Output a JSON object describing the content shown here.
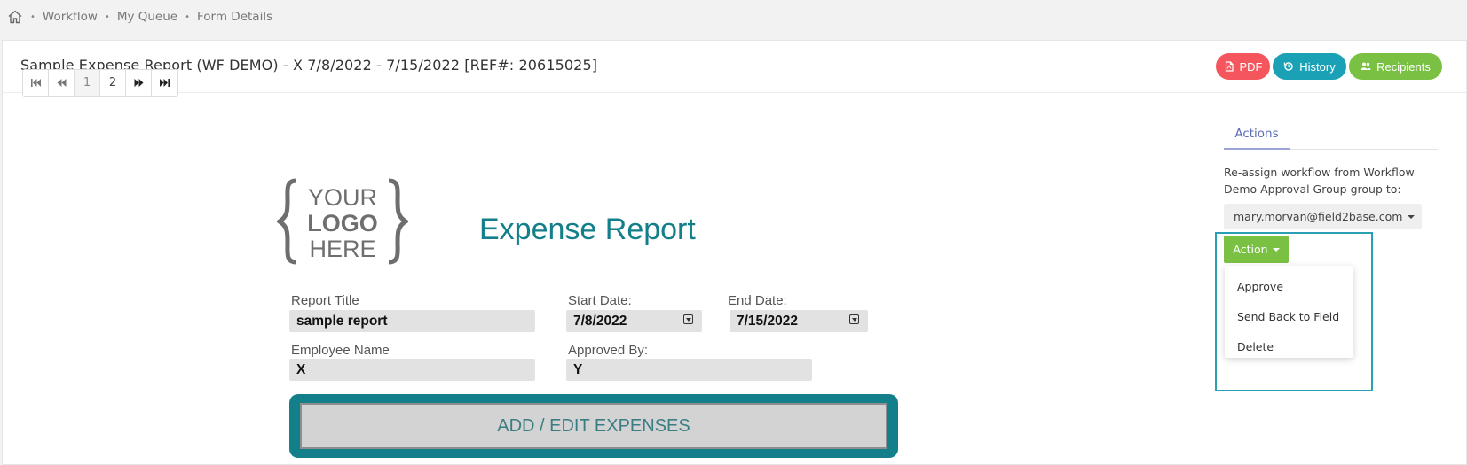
{
  "breadcrumb": {
    "items": [
      "Workflow",
      "My Queue",
      "Form Details"
    ]
  },
  "header": {
    "title": "Sample Expense Report (WF DEMO) - X 7/8/2022 - 7/15/2022 [REF#: 20615025]",
    "pdf_label": "PDF",
    "history_label": "History",
    "recipients_label": "Recipients"
  },
  "pager": {
    "pages": [
      "1",
      "2"
    ],
    "active_page": "1"
  },
  "form": {
    "logo_lines": [
      "YOUR",
      "LOGO",
      "HERE"
    ],
    "heading": "Expense Report",
    "report_title_label": "Report Title",
    "report_title_value": "sample report",
    "start_date_label": "Start Date:",
    "start_date_value": "7/8/2022",
    "end_date_label": "End Date:",
    "end_date_value": "7/15/2022",
    "employee_label": "Employee Name",
    "employee_value": "X",
    "approved_label": "Approved By:",
    "approved_value": "Y",
    "expenses_button": "ADD / EDIT EXPENSES"
  },
  "actions": {
    "tab_label": "Actions",
    "reassign_text": "Re-assign workflow from Workflow Demo Approval Group group to:",
    "assignee": "mary.morvan@field2base.com",
    "action_button": "Action",
    "menu": [
      "Approve",
      "Send Back to Field",
      "Delete"
    ]
  },
  "colors": {
    "teal": "#137f8a",
    "pdf": "#f5555d",
    "history": "#1aa1b6",
    "green": "#7ac143",
    "highlight": "#2aa0b5"
  }
}
